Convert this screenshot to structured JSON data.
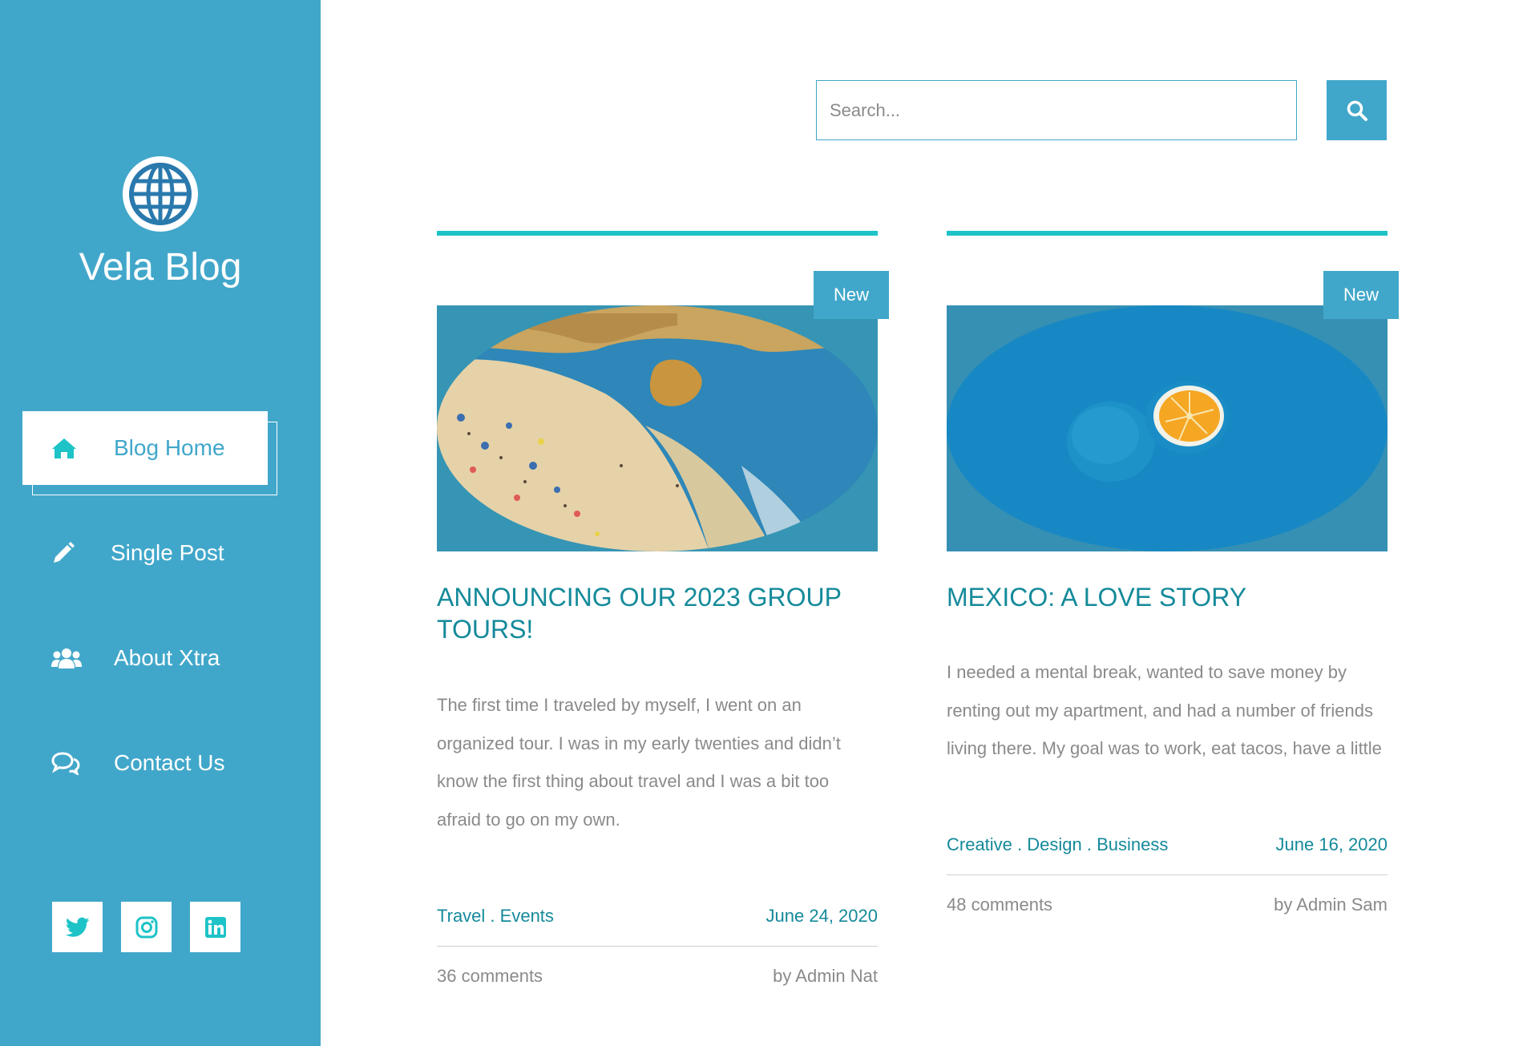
{
  "brand": {
    "title": "Vela Blog",
    "icon": "globe-icon"
  },
  "colors": {
    "sidebar": "#41a7ca",
    "accent": "#1ec3c7",
    "heading": "#148a9a",
    "text": "#8a8a8a"
  },
  "nav": [
    {
      "label": "Blog Home",
      "icon": "home-icon",
      "active": true
    },
    {
      "label": "Single Post",
      "icon": "pencil-icon",
      "active": false
    },
    {
      "label": "About Xtra",
      "icon": "users-icon",
      "active": false
    },
    {
      "label": "Contact Us",
      "icon": "comments-icon",
      "active": false
    }
  ],
  "social": [
    {
      "name": "twitter",
      "icon": "twitter-icon"
    },
    {
      "name": "instagram",
      "icon": "instagram-icon"
    },
    {
      "name": "linkedin",
      "icon": "linkedin-icon"
    }
  ],
  "search": {
    "placeholder": "Search...",
    "value": "",
    "button_icon": "search-icon"
  },
  "posts": [
    {
      "badge": "New",
      "title": "ANNOUNCING OUR 2023 GROUP TOURS!",
      "excerpt": "The first time I traveled by myself, I went on an organized tour. I was in my early twenties and didn’t know the first thing about travel and I was a bit too afraid to go on my own.",
      "categories": [
        "Travel",
        "Events"
      ],
      "category_sep": " . ",
      "date": "June 24, 2020",
      "comments": "36 comments",
      "author": "by Admin Nat"
    },
    {
      "badge": "New",
      "title": "MEXICO: A LOVE STORY",
      "excerpt": "I needed a mental break, wanted to save money by renting out my apartment, and had a number of friends living there. My goal was to work, eat tacos, have a little",
      "categories": [
        "Creative",
        "Design",
        "Business"
      ],
      "category_sep": " . ",
      "date": "June 16, 2020",
      "comments": "48 comments",
      "author": "by Admin Sam"
    }
  ]
}
